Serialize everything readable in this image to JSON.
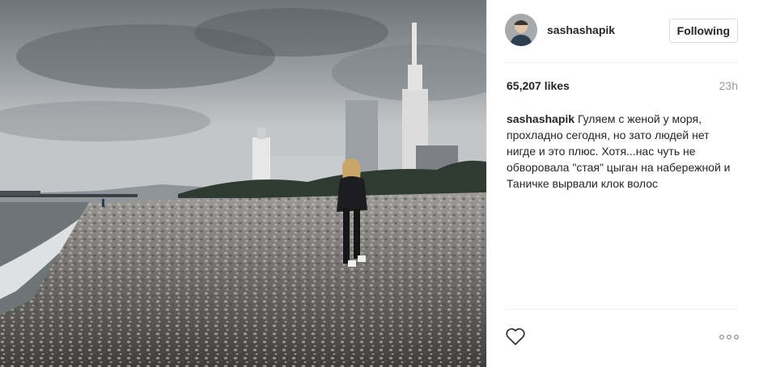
{
  "post": {
    "username": "sashashapik",
    "follow_label": "Following",
    "likes": "65,207 likes",
    "time_ago": "23h",
    "caption_user": "sashashapik",
    "caption_text": "Гуляем с женой у моря, прохладно сегодня, но зато людей нет нигде и это плюс. Хотя...нас чуть не обворовала \"стая\" цыган на набережной и Таничке вырвали клок волос"
  },
  "icons": {
    "like": "heart-icon",
    "more": "more-options-icon"
  },
  "colors": {
    "text": "#262626",
    "muted": "#999999",
    "border": "#dbdbdb"
  }
}
